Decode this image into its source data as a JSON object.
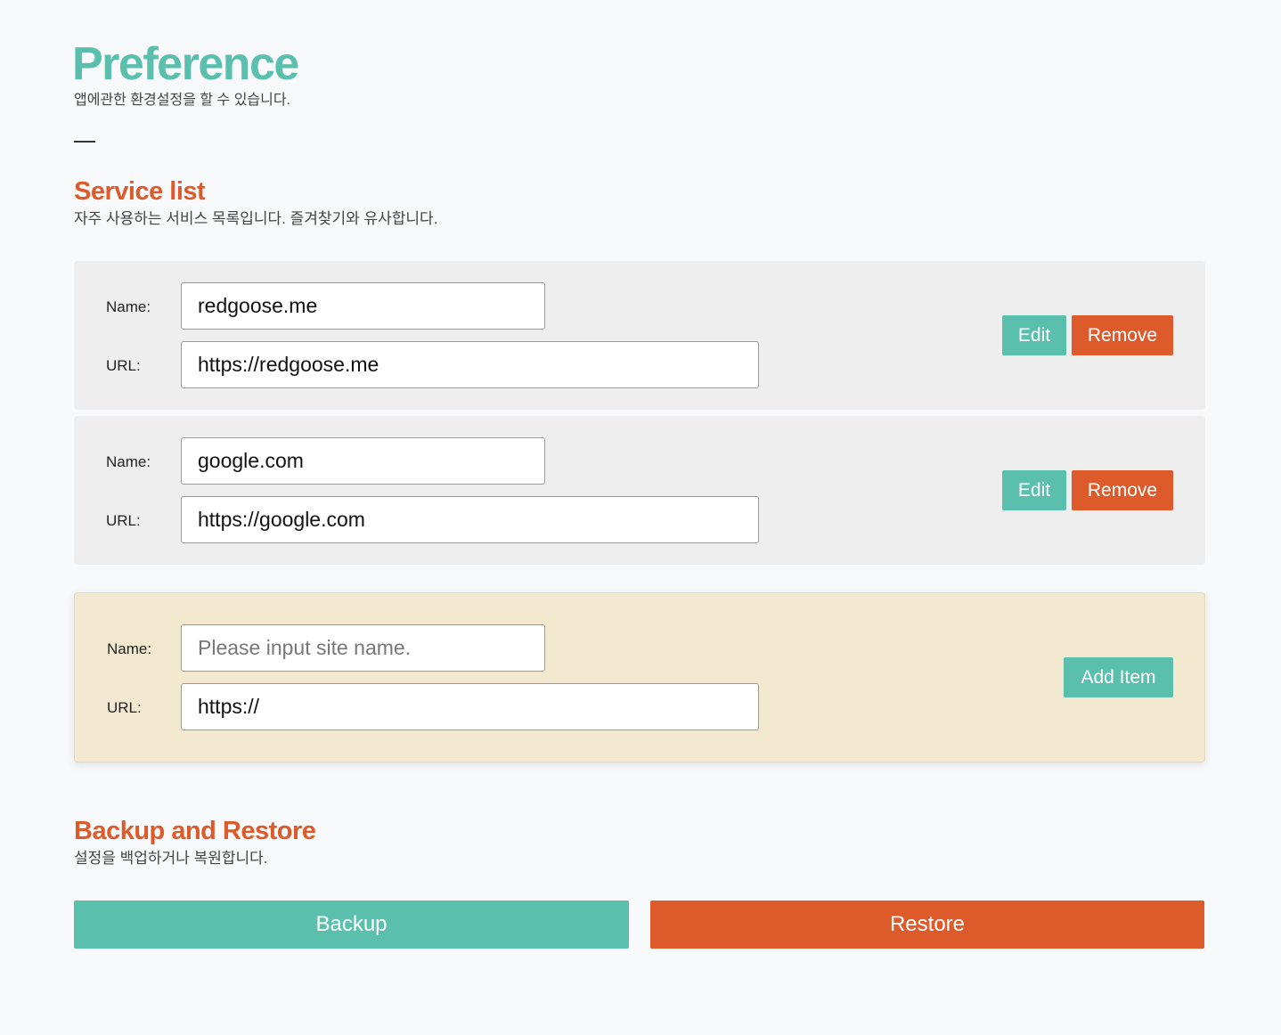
{
  "header": {
    "title": "Preference",
    "description": "앱에관한 환경설정을 할 수 있습니다."
  },
  "service_list": {
    "title": "Service list",
    "description": "자주 사용하는 서비스 목록입니다. 즐겨찾기와 유사합니다.",
    "items": [
      {
        "name_label": "Name:",
        "name_value": "redgoose.me",
        "url_label": "URL:",
        "url_value": "https://redgoose.me",
        "edit_label": "Edit",
        "remove_label": "Remove"
      },
      {
        "name_label": "Name:",
        "name_value": "google.com",
        "url_label": "URL:",
        "url_value": "https://google.com",
        "edit_label": "Edit",
        "remove_label": "Remove"
      }
    ],
    "new_item": {
      "name_label": "Name:",
      "name_placeholder": "Please input site name.",
      "name_value": "",
      "url_label": "URL:",
      "url_value": "https://",
      "add_label": "Add Item"
    }
  },
  "backup": {
    "title": "Backup and Restore",
    "description": "설정을 백업하거나 복원합니다.",
    "backup_label": "Backup",
    "restore_label": "Restore"
  },
  "colors": {
    "accent": "#5bbfad",
    "danger": "#dd5a2b",
    "new_item_bg": "#f2e9d0",
    "card_bg": "#eeeeee"
  }
}
